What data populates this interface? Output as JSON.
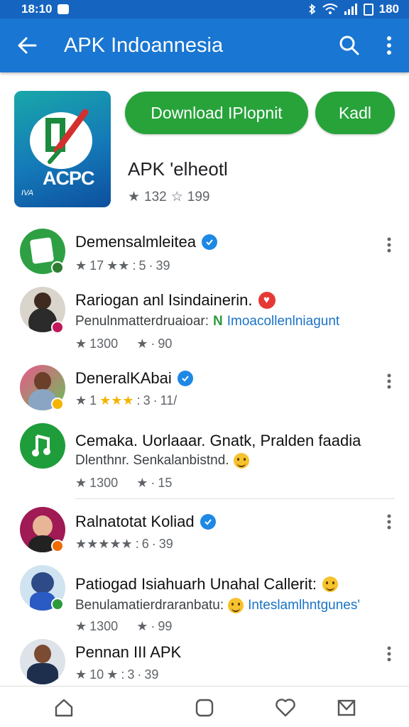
{
  "status_bar": {
    "time": "18:10",
    "battery": "180"
  },
  "app_bar": {
    "title": "APK Indoannesia"
  },
  "hero": {
    "logo_text": "ACPC",
    "logo_sub": "IVA",
    "download_button": "Download IPlopnit",
    "secondary_button": "Kadl",
    "app_name": "APK 'elheotl",
    "rating": "132",
    "reviews": "199"
  },
  "items": [
    {
      "name": "Demensalmleitea",
      "meta_left": "17",
      "meta_mid": "5",
      "meta_right": "39"
    },
    {
      "name": "Rariogan anl Isindainerin.",
      "sub": "Penulnmatterdruaioar:",
      "sub_accent": "Imoacollenlniagunt",
      "meta_left": "1300",
      "meta_right": "90"
    },
    {
      "name": "DeneralKAbai",
      "meta_left": "1",
      "meta_mid": "3",
      "meta_right": "11/"
    },
    {
      "name": "Cemaka. Uorlaaar. Gnatk, Pralden faadia",
      "sub": "Dlenthnr. Senkalanbistnd.",
      "meta_left": "1300",
      "meta_right": "15"
    },
    {
      "name": "Ralnatotat Koliad",
      "meta_mid": "6",
      "meta_right": "39"
    },
    {
      "name": "Patiogad Isiahuarh Unahal Callerit:",
      "sub": "Benulamatierdraranbatu:",
      "sub_accent": "Inteslamlhntgunes'",
      "meta_left": "1300",
      "meta_right": "99"
    },
    {
      "name": "Pennan III APK",
      "meta_left": "10",
      "meta_mid": "3",
      "meta_right": "39"
    }
  ]
}
